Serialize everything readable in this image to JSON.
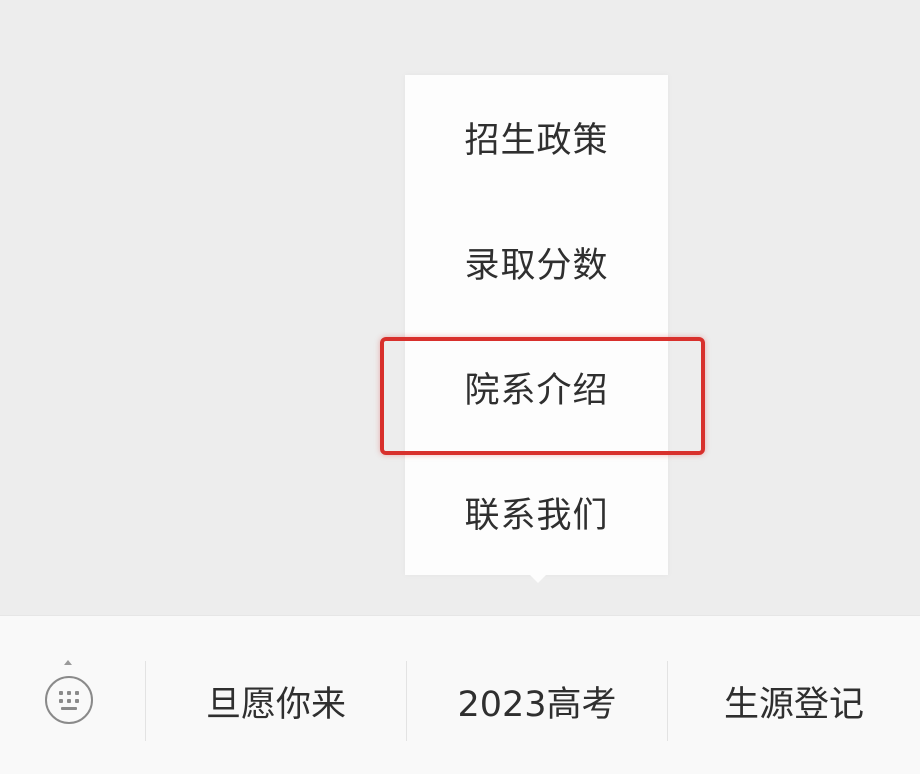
{
  "popup_menu": {
    "items": [
      {
        "label": "招生政策"
      },
      {
        "label": "录取分数"
      },
      {
        "label": "院系介绍",
        "highlighted": true
      },
      {
        "label": "联系我们"
      }
    ],
    "highlight_color": "#d8302c"
  },
  "bottom_bar": {
    "keyboard_icon": "keyboard-icon",
    "tabs": [
      {
        "label": "旦愿你来"
      },
      {
        "label": "2023高考"
      },
      {
        "label": "生源登记"
      }
    ]
  }
}
